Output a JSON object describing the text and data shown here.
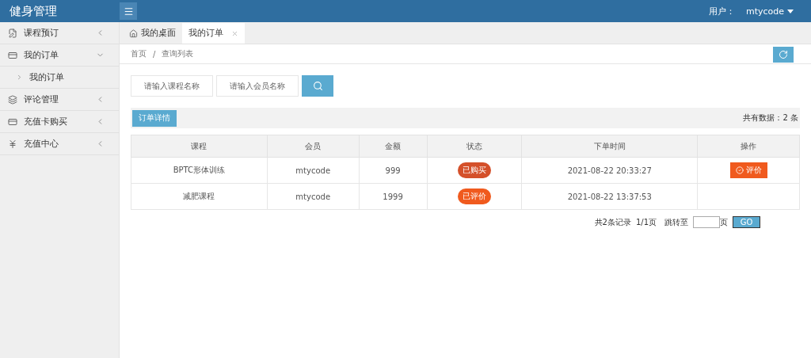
{
  "header": {
    "title": "健身管理",
    "user_label": "用户：",
    "user_name": "mtycode"
  },
  "sidebar": {
    "items": [
      {
        "label": "课程预订",
        "expanded": false
      },
      {
        "label": "我的订单",
        "expanded": true,
        "children": [
          {
            "label": "我的订单"
          }
        ]
      },
      {
        "label": "评论管理",
        "expanded": false
      },
      {
        "label": "充值卡购买",
        "expanded": false
      },
      {
        "label": "充值中心",
        "expanded": false
      }
    ]
  },
  "tabs": [
    {
      "label": "我的桌面",
      "selected": false,
      "home": true
    },
    {
      "label": "我的订单",
      "selected": true,
      "closable": true
    }
  ],
  "breadcrumb": {
    "items": [
      "首页",
      "查询列表"
    ],
    "separator": "/"
  },
  "search": {
    "fields": [
      {
        "placeholder": "请输入课程名称"
      },
      {
        "placeholder": "请输入会员名称"
      }
    ]
  },
  "toolbar": {
    "button": "订单详情",
    "count": "共有数据：2 条"
  },
  "table": {
    "columns": [
      "课程",
      "会员",
      "金额",
      "状态",
      "下单时间",
      "操作"
    ],
    "rows": [
      {
        "course": "BPTC形体训练",
        "member": "mtycode",
        "amount": "999",
        "status": "已购买",
        "color": "#d4502a",
        "time": "2021-08-22 20:33:27",
        "action": "评价"
      },
      {
        "course": "减肥课程",
        "member": "mtycode",
        "amount": "1999",
        "status": "已评价",
        "color": "#f05a1e",
        "time": "2021-08-22 13:37:53"
      }
    ]
  },
  "pagination": {
    "summary": "共2条记录",
    "pages": "1/1页",
    "jump_label": "跳转至",
    "page_unit": "页",
    "go": "GO"
  }
}
